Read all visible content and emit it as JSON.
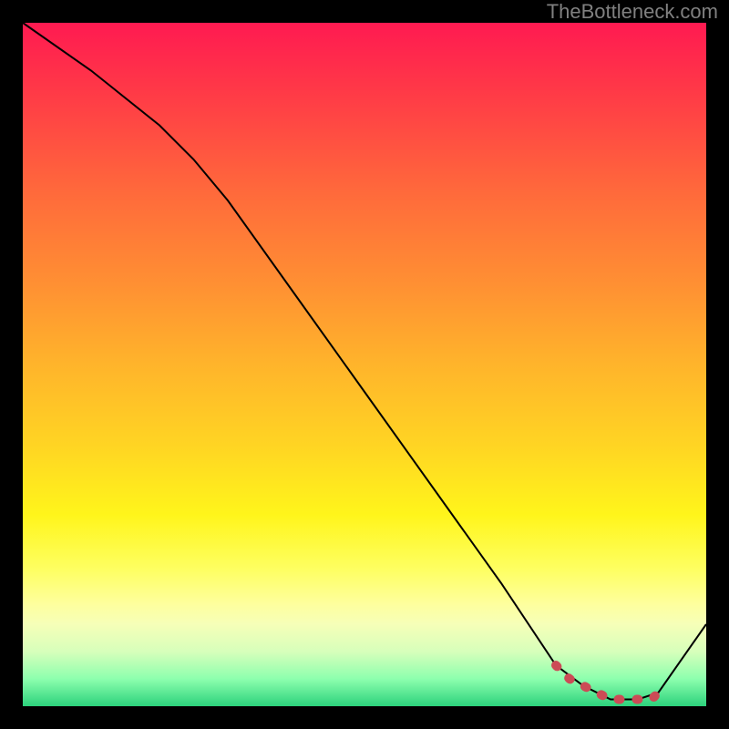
{
  "watermark": "TheBottleneck.com",
  "colors": {
    "frame": "#000000",
    "line": "#000000",
    "marker": "#cc4b56",
    "gradient_stops": [
      "#ff1a51",
      "#ff3947",
      "#ff6a3b",
      "#ff8f33",
      "#ffb42b",
      "#ffd523",
      "#fff51b",
      "#feff62",
      "#feff9d",
      "#f6ffb8",
      "#d7ffbb",
      "#8dffae",
      "#2cd27c"
    ]
  },
  "chart_data": {
    "type": "line",
    "title": "",
    "xlabel": "",
    "ylabel": "",
    "xlim": [
      0,
      100
    ],
    "ylim": [
      0,
      100
    ],
    "grid": false,
    "legend": false,
    "series": [
      {
        "name": "bottleneck-curve",
        "x": [
          0,
          10,
          20,
          25,
          30,
          40,
          50,
          60,
          70,
          78,
          82,
          86,
          90,
          93,
          100
        ],
        "y": [
          100,
          93,
          85,
          80,
          74,
          60,
          46,
          32,
          18,
          6,
          3,
          1,
          1,
          2,
          12
        ]
      }
    ],
    "markers": [
      {
        "name": "optimal-range",
        "x": [
          78,
          80,
          82,
          84,
          86,
          88,
          90,
          92,
          93
        ],
        "y": [
          6,
          4,
          3,
          2,
          1,
          1,
          1,
          1,
          2
        ]
      }
    ]
  }
}
